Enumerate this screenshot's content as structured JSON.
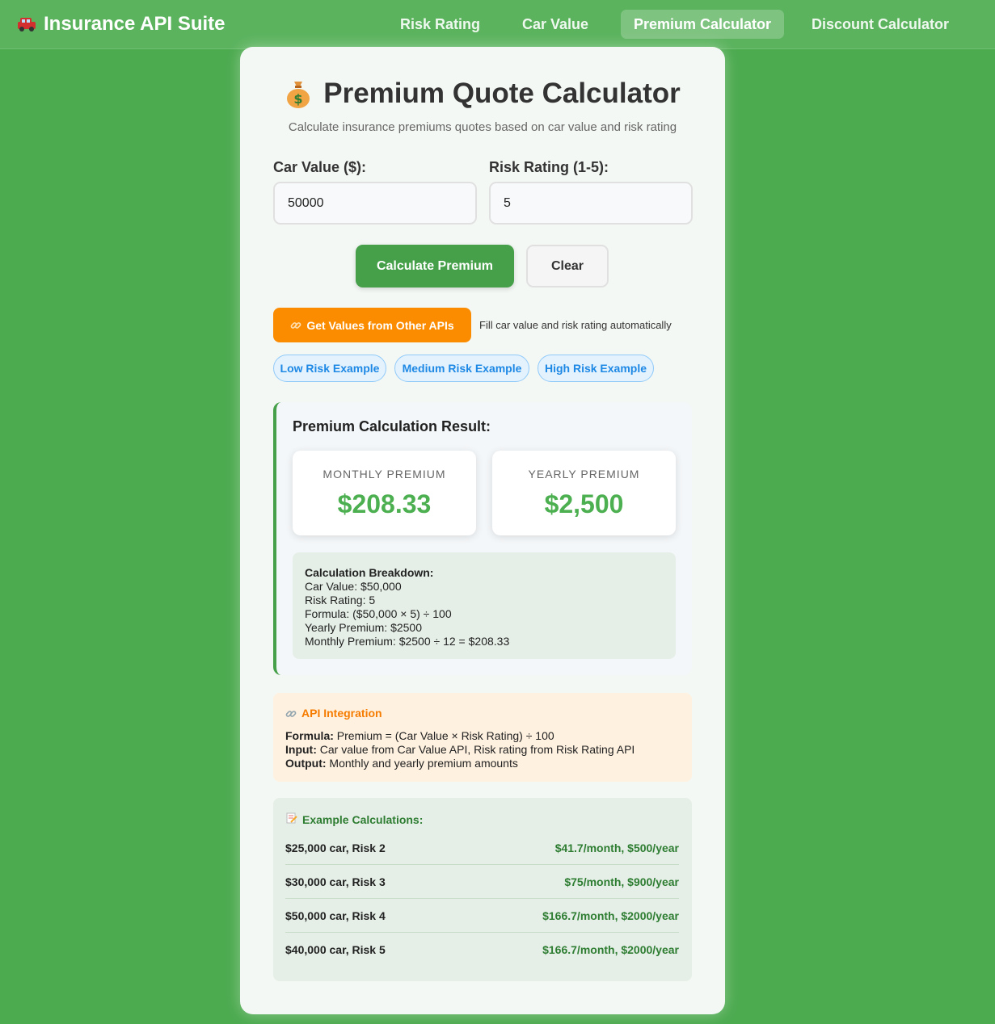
{
  "nav": {
    "brand": "Insurance API Suite",
    "links": [
      "Risk Rating",
      "Car Value",
      "Premium Calculator",
      "Discount Calculator"
    ],
    "active": "Premium Calculator"
  },
  "page": {
    "title": "Premium Quote Calculator",
    "subtitle": "Calculate insurance premiums quotes based on car value and risk rating"
  },
  "form": {
    "car_value_label": "Car Value ($):",
    "car_value": "50000",
    "risk_rating_label": "Risk Rating (1-5):",
    "risk_rating": "5",
    "calculate_label": "Calculate Premium",
    "clear_label": "Clear",
    "get_values_label": "Get Values from Other APIs",
    "get_values_hint": "Fill car value and risk rating automatically",
    "examples": [
      "Low Risk Example",
      "Medium Risk Example",
      "High Risk Example"
    ]
  },
  "result": {
    "title": "Premium Calculation Result:",
    "monthly_label": "MONTHLY PREMIUM",
    "monthly_value": "$208.33",
    "yearly_label": "YEARLY PREMIUM",
    "yearly_value": "$2,500",
    "breakdown_title": "Calculation Breakdown:",
    "breakdown_lines": [
      "Car Value: $50,000",
      "Risk Rating: 5",
      "Formula: ($50,000 × 5) ÷ 100",
      "Yearly Premium: $2500",
      "Monthly Premium: $2500 ÷ 12 = $208.33"
    ]
  },
  "api": {
    "title": "API Integration",
    "formula_label": "Formula:",
    "formula_text": "Premium = (Car Value × Risk Rating) ÷ 100",
    "input_label": "Input:",
    "input_text": "Car value from Car Value API, Risk rating from Risk Rating API",
    "output_label": "Output:",
    "output_text": "Monthly and yearly premium amounts"
  },
  "examples": {
    "title": "Example Calculations:",
    "rows": [
      {
        "left": "$25,000 car, Risk 2",
        "right": "$41.7/month, $500/year"
      },
      {
        "left": "$30,000 car, Risk 3",
        "right": "$75/month, $900/year"
      },
      {
        "left": "$50,000 car, Risk 4",
        "right": "$166.7/month, $2000/year"
      },
      {
        "left": "$40,000 car, Risk 5",
        "right": "$166.7/month, $2000/year"
      }
    ]
  },
  "colors": {
    "background": "#4caa4f",
    "primary": "#45a049",
    "accent_orange": "#fb8c00",
    "premium_green": "#4caf50",
    "pill_blue": "#1e88e5"
  },
  "icons": {
    "brand": "car-icon",
    "title": "money-bag-icon",
    "link": "link-icon",
    "memo": "memo-icon"
  }
}
